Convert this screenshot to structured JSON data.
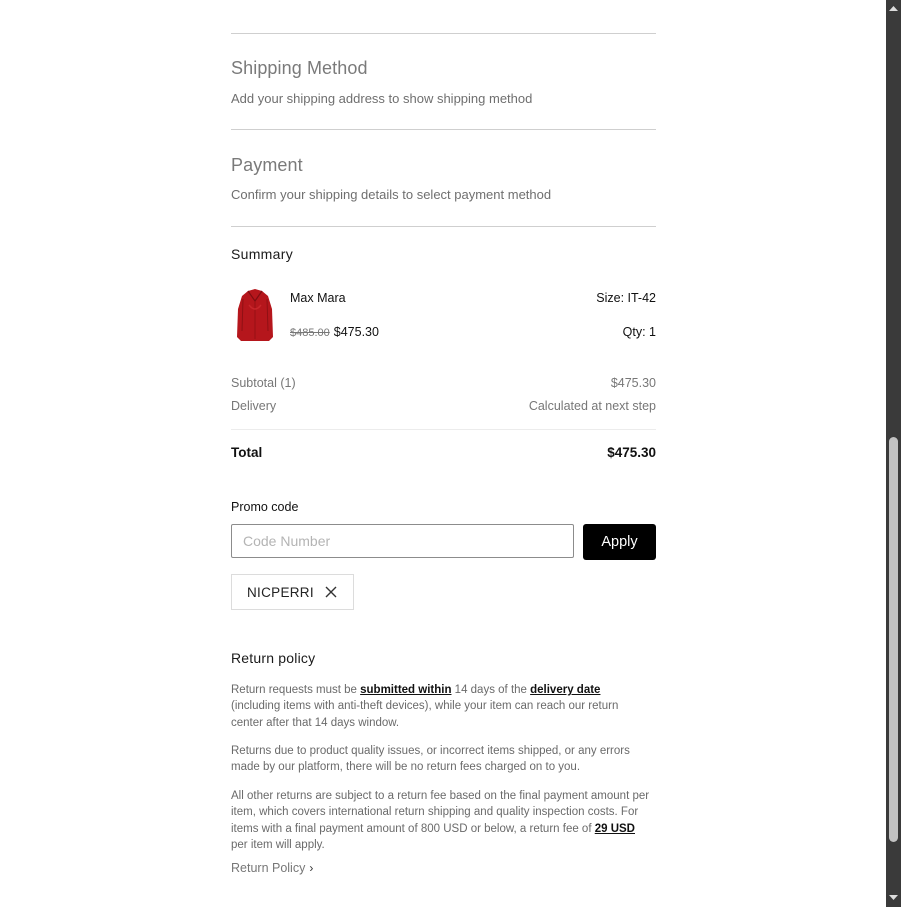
{
  "shipping": {
    "title": "Shipping Method",
    "subtitle": "Add your shipping address to show shipping method"
  },
  "payment": {
    "title": "Payment",
    "subtitle": "Confirm your shipping details to select payment method"
  },
  "summary": {
    "title": "Summary",
    "item": {
      "brand": "Max Mara",
      "size": "Size: IT-42",
      "original_price": "$485.00",
      "price": "$475.30",
      "qty": "Qty: 1",
      "image_icon": "red-blouse-thumbnail",
      "image_color": "#b5161c"
    },
    "subtotal_label": "Subtotal (1)",
    "subtotal_value": "$475.30",
    "delivery_label": "Delivery",
    "delivery_value": "Calculated at next step",
    "total_label": "Total",
    "total_value": "$475.30"
  },
  "promo": {
    "label": "Promo code",
    "placeholder": "Code Number",
    "value": "",
    "apply_label": "Apply",
    "applied_code": "NICPERRI",
    "remove_icon": "close-icon"
  },
  "return_policy": {
    "title": "Return policy",
    "para1": {
      "t1": "Return requests must be ",
      "link1": "submitted within",
      "t2": " 14 days of the ",
      "link2": "delivery date",
      "t3": " (including items with anti-theft devices), while your item can reach our return center after that 14 days window."
    },
    "para2": "Returns due to product quality issues, or incorrect items shipped, or any errors made by our platform, there will be no return fees charged on to you.",
    "para3": {
      "t1": "All other returns are subject to a return fee based on the final payment amount per item, which covers international return shipping and quality inspection costs. For items with a final payment amount of 800 USD or below, a return fee of ",
      "link": "29 USD",
      "t2": " per item will apply."
    },
    "link_label": "Return Policy",
    "link_icon": "chevron-right-icon"
  },
  "colors": {
    "button_bg": "#000000",
    "divider": "#cfcfcf",
    "muted_text": "#777777",
    "scrollbar_track": "#3a3a3a",
    "scrollbar_thumb": "#c2c2c2"
  }
}
